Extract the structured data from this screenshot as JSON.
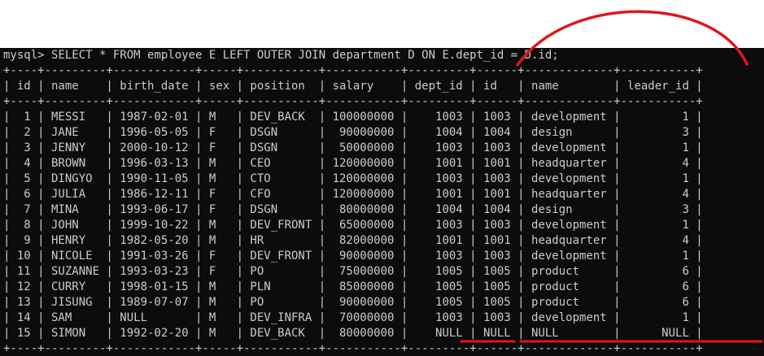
{
  "prompt": "mysql>",
  "query": "SELECT * FROM employee E LEFT OUTER JOIN department D ON E.dept_id = D.id;",
  "table": {
    "columns": [
      "id",
      "name",
      "birth_date",
      "sex",
      "position",
      "salary",
      "dept_id",
      "id",
      "name",
      "leader_id"
    ],
    "rows": [
      [
        "1",
        "MESSI",
        "1987-02-01",
        "M",
        "DEV_BACK",
        "100000000",
        "1003",
        "1003",
        "development",
        "1"
      ],
      [
        "2",
        "JANE",
        "1996-05-05",
        "F",
        "DSGN",
        "90000000",
        "1004",
        "1004",
        "design",
        "3"
      ],
      [
        "3",
        "JENNY",
        "2000-10-12",
        "F",
        "DSGN",
        "50000000",
        "1003",
        "1003",
        "development",
        "1"
      ],
      [
        "4",
        "BROWN",
        "1996-03-13",
        "M",
        "CEO",
        "120000000",
        "1001",
        "1001",
        "headquarter",
        "4"
      ],
      [
        "5",
        "DINGYO",
        "1990-11-05",
        "M",
        "CTO",
        "120000000",
        "1003",
        "1003",
        "development",
        "1"
      ],
      [
        "6",
        "JULIA",
        "1986-12-11",
        "F",
        "CFO",
        "120000000",
        "1001",
        "1001",
        "headquarter",
        "4"
      ],
      [
        "7",
        "MINA",
        "1993-06-17",
        "F",
        "DSGN",
        "80000000",
        "1004",
        "1004",
        "design",
        "3"
      ],
      [
        "8",
        "JOHN",
        "1999-10-22",
        "M",
        "DEV_FRONT",
        "65000000",
        "1003",
        "1003",
        "development",
        "1"
      ],
      [
        "9",
        "HENRY",
        "1982-05-20",
        "M",
        "HR",
        "82000000",
        "1001",
        "1001",
        "headquarter",
        "4"
      ],
      [
        "10",
        "NICOLE",
        "1991-03-26",
        "F",
        "DEV_FRONT",
        "90000000",
        "1003",
        "1003",
        "development",
        "1"
      ],
      [
        "11",
        "SUZANNE",
        "1993-03-23",
        "F",
        "PO",
        "75000000",
        "1005",
        "1005",
        "product",
        "6"
      ],
      [
        "12",
        "CURRY",
        "1998-01-15",
        "M",
        "PLN",
        "85000000",
        "1005",
        "1005",
        "product",
        "6"
      ],
      [
        "13",
        "JISUNG",
        "1989-07-07",
        "M",
        "PO",
        "90000000",
        "1005",
        "1005",
        "product",
        "6"
      ],
      [
        "14",
        "SAM",
        "NULL",
        "M",
        "DEV_INFRA",
        "70000000",
        "1003",
        "1003",
        "development",
        "1"
      ],
      [
        "15",
        "SIMON",
        "1992-02-20",
        "M",
        "DEV_BACK",
        "80000000",
        "NULL",
        "NULL",
        "NULL",
        "NULL"
      ]
    ]
  },
  "colors": {
    "terminal_background": "#0c0c0c",
    "terminal_text": "#cccccc",
    "annotation": "#e0161c"
  }
}
